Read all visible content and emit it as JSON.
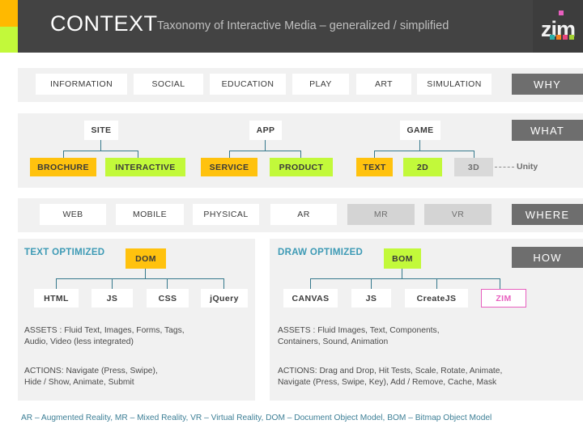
{
  "header": {
    "title": "CONTEXT",
    "subtitle": "Taxonomy of Interactive Media – generalized / simplified",
    "logo_text": "zim",
    "logo_colors": [
      "#E85FBF",
      "#2BB0A8",
      "#F58220",
      "#E8457C",
      "#A4D233"
    ],
    "bg": "#434343",
    "accent_orange": "#FFB900",
    "accent_green": "#C2F93A"
  },
  "tabs": [
    {
      "label": "WHY"
    },
    {
      "label": "WHAT"
    },
    {
      "label": "WHERE"
    },
    {
      "label": "HOW"
    }
  ],
  "row_why": {
    "items": [
      {
        "label": "INFORMATION",
        "style": "white"
      },
      {
        "label": "SOCIAL",
        "style": "white"
      },
      {
        "label": "EDUCATION",
        "style": "white"
      },
      {
        "label": "PLAY",
        "style": "white"
      },
      {
        "label": "ART",
        "style": "white"
      },
      {
        "label": "SIMULATION",
        "style": "white"
      }
    ]
  },
  "row_what": {
    "groups": [
      {
        "parent": "SITE",
        "children": [
          {
            "label": "BROCHURE",
            "style": "orange"
          },
          {
            "label": "INTERACTIVE",
            "style": "green"
          }
        ]
      },
      {
        "parent": "APP",
        "children": [
          {
            "label": "SERVICE",
            "style": "orange"
          },
          {
            "label": "PRODUCT",
            "style": "green"
          }
        ]
      },
      {
        "parent": "GAME",
        "children": [
          {
            "label": "TEXT",
            "style": "orange"
          },
          {
            "label": "2D",
            "style": "green"
          },
          {
            "label": "3D",
            "style": "grey-node"
          }
        ]
      }
    ],
    "annotation": "Unity"
  },
  "row_where": {
    "items": [
      {
        "label": "WEB",
        "style": "white"
      },
      {
        "label": "MOBILE",
        "style": "white"
      },
      {
        "label": "PHYSICAL",
        "style": "white"
      },
      {
        "label": "AR",
        "style": "white"
      },
      {
        "label": "MR",
        "style": "grey"
      },
      {
        "label": "VR",
        "style": "grey"
      }
    ]
  },
  "how": {
    "left": {
      "optimized_label": "TEXT OPTIMIZED",
      "root": "DOM",
      "root_style": "orange",
      "children": [
        "HTML",
        "JS",
        "CSS",
        "jQuery"
      ],
      "assets_head": "ASSETS : ",
      "assets_line1": "Fluid Text,  Images,  Forms,  Tags,",
      "assets_line2": "Audio,  Video  (less integrated)",
      "actions_head": "ACTIONS: ",
      "actions_line1": "Navigate (Press, Swipe),",
      "actions_line2": "Hide / Show,  Animate,  Submit"
    },
    "right": {
      "optimized_label": "DRAW OPTIMIZED",
      "root": "BOM",
      "root_style": "green",
      "children": [
        "CANVAS",
        "JS",
        "CreateJS",
        "ZIM"
      ],
      "assets_head": "ASSETS : ",
      "assets_line1": "Fluid Images,  Text,  Components,",
      "assets_line2": "Containers,  Sound,  Animation",
      "actions_head": "ACTIONS: ",
      "actions_line1": "Drag and Drop, Hit Tests, Scale, Rotate, Animate,",
      "actions_line2": "Navigate (Press, Swipe, Key),  Add / Remove,  Cache,  Mask"
    }
  },
  "footer": "AR – Augmented Reality,  MR – Mixed Reality,  VR – Virtual Reality,  DOM – Document Object Model,  BOM – Bitmap Object Model",
  "colors": {
    "orange": "#FFC20E",
    "green": "#C2F93A",
    "tab_grey": "#6e6e6e",
    "band": "#f1f1f1",
    "line_teal": "#35788c",
    "accent_teal": "#3d9ab5",
    "zim_pink": "#E85FBF"
  }
}
